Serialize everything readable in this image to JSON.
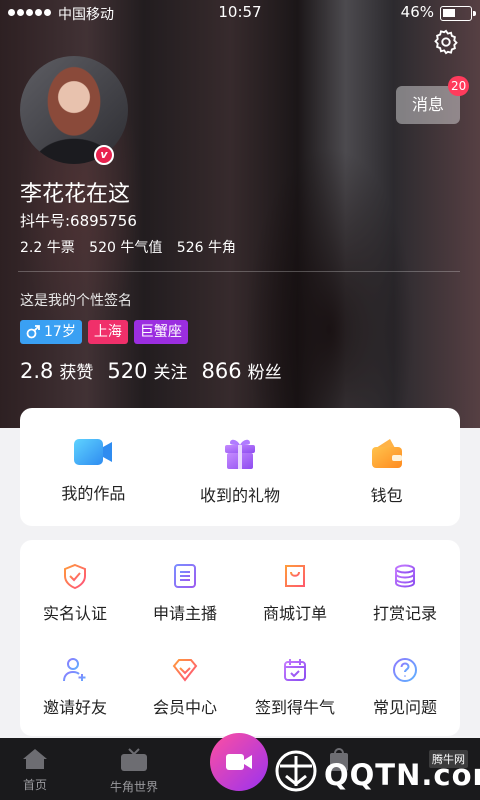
{
  "status": {
    "carrier": "中国移动",
    "time": "10:57",
    "battery": "46%"
  },
  "profile": {
    "name": "李花花在这",
    "id_text": "抖牛号:6895756",
    "currency": [
      "2.2 牛票",
      "520 牛气值",
      "526 牛角"
    ],
    "signature": "这是我的个性签名",
    "tags": {
      "gender_age": "17岁",
      "city": "上海",
      "zodiac": "巨蟹座"
    },
    "stats": [
      {
        "value": "2.8",
        "label": "获赞"
      },
      {
        "value": "520",
        "label": "关注"
      },
      {
        "value": "866",
        "label": "粉丝"
      }
    ]
  },
  "message": {
    "label": "消息",
    "count": "20"
  },
  "quick": [
    {
      "label": "我的作品",
      "icon": "video-camera-icon"
    },
    {
      "label": "收到的礼物",
      "icon": "gift-icon"
    },
    {
      "label": "钱包",
      "icon": "wallet-icon"
    }
  ],
  "services": [
    {
      "label": "实名认证",
      "icon": "shield-check-icon"
    },
    {
      "label": "申请主播",
      "icon": "document-list-icon"
    },
    {
      "label": "商城订单",
      "icon": "shopping-bag-icon"
    },
    {
      "label": "打赏记录",
      "icon": "coin-stack-icon"
    },
    {
      "label": "邀请好友",
      "icon": "add-user-icon"
    },
    {
      "label": "会员中心",
      "icon": "diamond-icon"
    },
    {
      "label": "签到得牛气",
      "icon": "calendar-check-icon"
    },
    {
      "label": "常见问题",
      "icon": "question-icon"
    }
  ],
  "tabs": {
    "home": "首页",
    "world": "牛角世界"
  },
  "watermark": {
    "site": "QQTN.com",
    "brand": "腾牛网"
  },
  "colors": {
    "accent_pink": "#f0306a",
    "accent_purple": "#9b2ee0",
    "accent_blue": "#3aa0f3",
    "badge_red": "#ff3b5c"
  }
}
